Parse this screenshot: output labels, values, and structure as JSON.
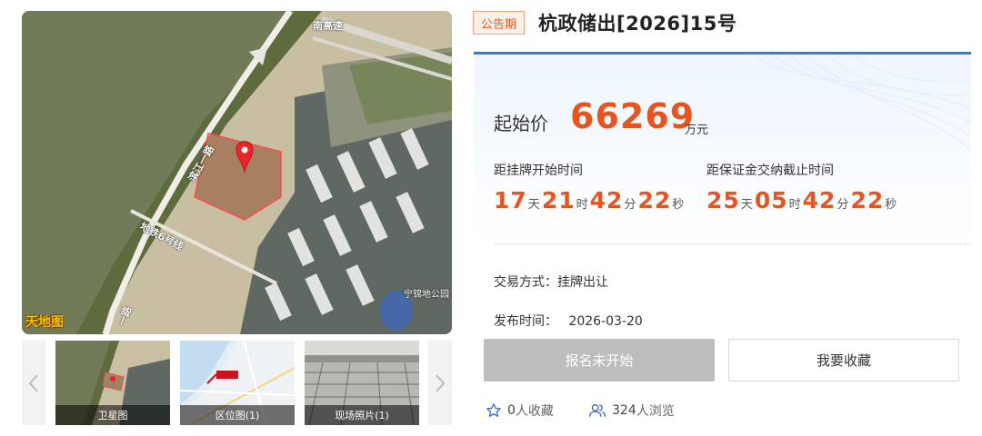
{
  "gallery": {
    "map_logo": "天地图",
    "road_labels": {
      "expressway": "南高速",
      "street": "滨江一路",
      "metro": "地铁6号线",
      "south_road": "一路",
      "park": "宁锦地公园"
    },
    "thumbnails": [
      {
        "label": "卫星图"
      },
      {
        "label": "区位图(1)"
      },
      {
        "label": "现场照片(1)"
      }
    ],
    "prev_icon": "chevron-left-icon",
    "next_icon": "chevron-right-icon"
  },
  "header": {
    "status_tag": "公告期",
    "title": "杭政储出[2026]15号"
  },
  "price": {
    "label": "起始价",
    "value": "66269",
    "unit": "万元"
  },
  "countdowns": [
    {
      "title": "距挂牌开始时间",
      "days": "17",
      "hours": "21",
      "minutes": "42",
      "seconds": "22"
    },
    {
      "title": "距保证金交纳截止时间",
      "days": "25",
      "hours": "05",
      "minutes": "42",
      "seconds": "22"
    }
  ],
  "units": {
    "day": "天",
    "hour": "时",
    "minute": "分",
    "second": "秒"
  },
  "details": {
    "trade_method": "交易方式：挂牌出让",
    "publish_label": "发布时间：",
    "publish_date": "2026-03-20"
  },
  "actions": {
    "register_label": "报名未开始",
    "collect_label": "我要收藏"
  },
  "stats": {
    "favorites_count": "0",
    "favorites_suffix": "人收藏",
    "views_count": "324",
    "views_suffix": "人浏览"
  },
  "colors": {
    "accent": "#e8541f",
    "panel_top": "#2d7be5",
    "icon_blue": "#3b6fd8"
  }
}
